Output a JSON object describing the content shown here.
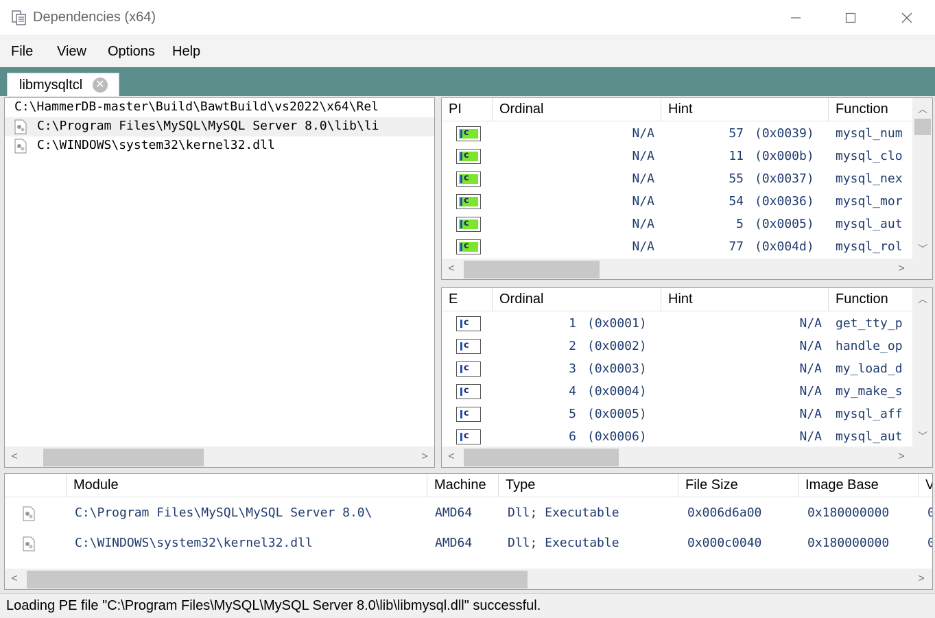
{
  "window": {
    "title": "Dependencies (x64)",
    "minimize_glyph": "—",
    "maximize_glyph": "☐",
    "close_glyph": "✕"
  },
  "menu": {
    "items": [
      "File",
      "View",
      "Options",
      "Help"
    ]
  },
  "tab": {
    "label": "libmysqltcl",
    "close_glyph": "✕"
  },
  "tree": {
    "items": [
      {
        "text": "C:\\HammerDB-master\\Build\\BawtBuild\\vs2022\\x64\\Rel",
        "icon": "none"
      },
      {
        "text": "C:\\Program Files\\MySQL\\MySQL Server 8.0\\lib\\li",
        "icon": "dll-file-icon"
      },
      {
        "text": "C:\\WINDOWS\\system32\\kernel32.dll",
        "icon": "dll-file-icon"
      }
    ]
  },
  "imports": {
    "headers": [
      "PI",
      "Ordinal",
      "Hint",
      "Function"
    ],
    "rows": [
      {
        "ordinal": "N/A",
        "hint": "57",
        "hint_hex": "(0x0039)",
        "function": "mysql_num"
      },
      {
        "ordinal": "N/A",
        "hint": "11",
        "hint_hex": "(0x000b)",
        "function": "mysql_clo"
      },
      {
        "ordinal": "N/A",
        "hint": "55",
        "hint_hex": "(0x0037)",
        "function": "mysql_nex"
      },
      {
        "ordinal": "N/A",
        "hint": "54",
        "hint_hex": "(0x0036)",
        "function": "mysql_mor"
      },
      {
        "ordinal": "N/A",
        "hint": "5",
        "hint_hex": "(0x0005)",
        "function": "mysql_aut"
      },
      {
        "ordinal": "N/A",
        "hint": "77",
        "hint_hex": "(0x004d)",
        "function": "mysql_rol"
      }
    ],
    "icon_color": "#7ce52e"
  },
  "exports": {
    "headers": [
      "E",
      "Ordinal",
      "Hint",
      "Function"
    ],
    "rows": [
      {
        "ordinal": "1",
        "ordinal_hex": "(0x0001)",
        "hint": "N/A",
        "function": "get_tty_p"
      },
      {
        "ordinal": "2",
        "ordinal_hex": "(0x0002)",
        "hint": "N/A",
        "function": "handle_op"
      },
      {
        "ordinal": "3",
        "ordinal_hex": "(0x0003)",
        "hint": "N/A",
        "function": "my_load_d"
      },
      {
        "ordinal": "4",
        "ordinal_hex": "(0x0004)",
        "hint": "N/A",
        "function": "my_make_s"
      },
      {
        "ordinal": "5",
        "ordinal_hex": "(0x0005)",
        "hint": "N/A",
        "function": "mysql_aff"
      },
      {
        "ordinal": "6",
        "ordinal_hex": "(0x0006)",
        "hint": "N/A",
        "function": "mysql_aut"
      }
    ]
  },
  "modules": {
    "headers": [
      "Module",
      "Machine",
      "Type",
      "File Size",
      "Image Base",
      "V"
    ],
    "rows": [
      {
        "module": "C:\\Program Files\\MySQL\\MySQL Server 8.0\\",
        "machine": "AMD64",
        "type": "Dll; Executable",
        "file_size": "0x006d6a00",
        "image_base": "0x180000000",
        "v": "0"
      },
      {
        "module": "C:\\WINDOWS\\system32\\kernel32.dll",
        "machine": "AMD64",
        "type": "Dll; Executable",
        "file_size": "0x000c0040",
        "image_base": "0x180000000",
        "v": "0"
      }
    ]
  },
  "status": {
    "text": "Loading PE file \"C:\\Program Files\\MySQL\\MySQL Server 8.0\\lib\\libmysql.dll\" successful."
  },
  "glyphs": {
    "left": "<",
    "right": ">",
    "up": "︿",
    "down": "﹀"
  }
}
